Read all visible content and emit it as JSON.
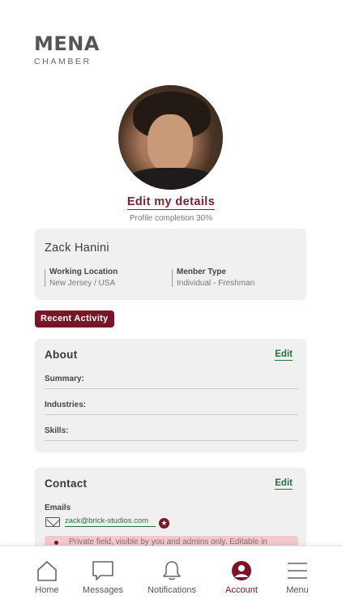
{
  "brand": {
    "top": "MENA",
    "bottom": "CHAMBER"
  },
  "profile": {
    "edit_label": "Edit my details",
    "completion": "Profile completion 30%",
    "name": "Zack Hanini",
    "working_location_label": "Working Location",
    "working_location_value": "New Jersey / USA",
    "member_type_label": "Menber Type",
    "member_type_value": "Individual - Freshman"
  },
  "recent_activity_label": "Recent Activity",
  "about": {
    "title": "About",
    "edit": "Edit",
    "fields": [
      "Summary:",
      "Industries:",
      "Skills:"
    ]
  },
  "contact": {
    "title": "Contact",
    "edit": "Edit",
    "emails_label": "Emails",
    "email": "zack@brick-studios.com",
    "private_note": "Private field, visible by you and admins only. Editable in"
  },
  "tabs": [
    {
      "label": "Home",
      "icon": "home-icon"
    },
    {
      "label": "Messages",
      "icon": "message-icon"
    },
    {
      "label": "Notifications",
      "icon": "bell-icon"
    },
    {
      "label": "Account",
      "icon": "account-icon"
    },
    {
      "label": "Menu",
      "icon": "menu-icon"
    }
  ],
  "colors": {
    "accent": "#7a1426",
    "link_green": "#2d6b3e",
    "card_bg": "#f0f0f0"
  }
}
